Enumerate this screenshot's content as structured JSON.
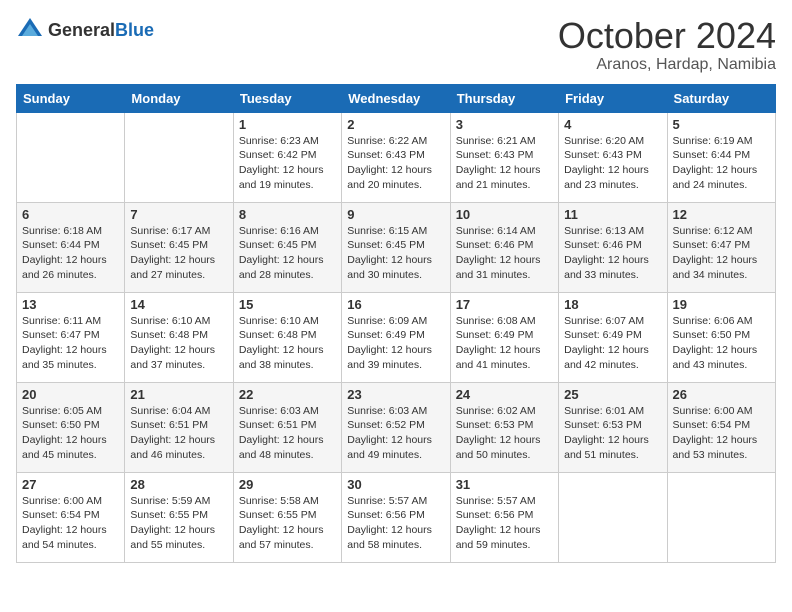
{
  "logo": {
    "general": "General",
    "blue": "Blue"
  },
  "header": {
    "month": "October 2024",
    "location": "Aranos, Hardap, Namibia"
  },
  "weekdays": [
    "Sunday",
    "Monday",
    "Tuesday",
    "Wednesday",
    "Thursday",
    "Friday",
    "Saturday"
  ],
  "weeks": [
    [
      {
        "day": "",
        "info": ""
      },
      {
        "day": "",
        "info": ""
      },
      {
        "day": "1",
        "info": "Sunrise: 6:23 AM\nSunset: 6:42 PM\nDaylight: 12 hours and 19 minutes."
      },
      {
        "day": "2",
        "info": "Sunrise: 6:22 AM\nSunset: 6:43 PM\nDaylight: 12 hours and 20 minutes."
      },
      {
        "day": "3",
        "info": "Sunrise: 6:21 AM\nSunset: 6:43 PM\nDaylight: 12 hours and 21 minutes."
      },
      {
        "day": "4",
        "info": "Sunrise: 6:20 AM\nSunset: 6:43 PM\nDaylight: 12 hours and 23 minutes."
      },
      {
        "day": "5",
        "info": "Sunrise: 6:19 AM\nSunset: 6:44 PM\nDaylight: 12 hours and 24 minutes."
      }
    ],
    [
      {
        "day": "6",
        "info": "Sunrise: 6:18 AM\nSunset: 6:44 PM\nDaylight: 12 hours and 26 minutes."
      },
      {
        "day": "7",
        "info": "Sunrise: 6:17 AM\nSunset: 6:45 PM\nDaylight: 12 hours and 27 minutes."
      },
      {
        "day": "8",
        "info": "Sunrise: 6:16 AM\nSunset: 6:45 PM\nDaylight: 12 hours and 28 minutes."
      },
      {
        "day": "9",
        "info": "Sunrise: 6:15 AM\nSunset: 6:45 PM\nDaylight: 12 hours and 30 minutes."
      },
      {
        "day": "10",
        "info": "Sunrise: 6:14 AM\nSunset: 6:46 PM\nDaylight: 12 hours and 31 minutes."
      },
      {
        "day": "11",
        "info": "Sunrise: 6:13 AM\nSunset: 6:46 PM\nDaylight: 12 hours and 33 minutes."
      },
      {
        "day": "12",
        "info": "Sunrise: 6:12 AM\nSunset: 6:47 PM\nDaylight: 12 hours and 34 minutes."
      }
    ],
    [
      {
        "day": "13",
        "info": "Sunrise: 6:11 AM\nSunset: 6:47 PM\nDaylight: 12 hours and 35 minutes."
      },
      {
        "day": "14",
        "info": "Sunrise: 6:10 AM\nSunset: 6:48 PM\nDaylight: 12 hours and 37 minutes."
      },
      {
        "day": "15",
        "info": "Sunrise: 6:10 AM\nSunset: 6:48 PM\nDaylight: 12 hours and 38 minutes."
      },
      {
        "day": "16",
        "info": "Sunrise: 6:09 AM\nSunset: 6:49 PM\nDaylight: 12 hours and 39 minutes."
      },
      {
        "day": "17",
        "info": "Sunrise: 6:08 AM\nSunset: 6:49 PM\nDaylight: 12 hours and 41 minutes."
      },
      {
        "day": "18",
        "info": "Sunrise: 6:07 AM\nSunset: 6:49 PM\nDaylight: 12 hours and 42 minutes."
      },
      {
        "day": "19",
        "info": "Sunrise: 6:06 AM\nSunset: 6:50 PM\nDaylight: 12 hours and 43 minutes."
      }
    ],
    [
      {
        "day": "20",
        "info": "Sunrise: 6:05 AM\nSunset: 6:50 PM\nDaylight: 12 hours and 45 minutes."
      },
      {
        "day": "21",
        "info": "Sunrise: 6:04 AM\nSunset: 6:51 PM\nDaylight: 12 hours and 46 minutes."
      },
      {
        "day": "22",
        "info": "Sunrise: 6:03 AM\nSunset: 6:51 PM\nDaylight: 12 hours and 48 minutes."
      },
      {
        "day": "23",
        "info": "Sunrise: 6:03 AM\nSunset: 6:52 PM\nDaylight: 12 hours and 49 minutes."
      },
      {
        "day": "24",
        "info": "Sunrise: 6:02 AM\nSunset: 6:53 PM\nDaylight: 12 hours and 50 minutes."
      },
      {
        "day": "25",
        "info": "Sunrise: 6:01 AM\nSunset: 6:53 PM\nDaylight: 12 hours and 51 minutes."
      },
      {
        "day": "26",
        "info": "Sunrise: 6:00 AM\nSunset: 6:54 PM\nDaylight: 12 hours and 53 minutes."
      }
    ],
    [
      {
        "day": "27",
        "info": "Sunrise: 6:00 AM\nSunset: 6:54 PM\nDaylight: 12 hours and 54 minutes."
      },
      {
        "day": "28",
        "info": "Sunrise: 5:59 AM\nSunset: 6:55 PM\nDaylight: 12 hours and 55 minutes."
      },
      {
        "day": "29",
        "info": "Sunrise: 5:58 AM\nSunset: 6:55 PM\nDaylight: 12 hours and 57 minutes."
      },
      {
        "day": "30",
        "info": "Sunrise: 5:57 AM\nSunset: 6:56 PM\nDaylight: 12 hours and 58 minutes."
      },
      {
        "day": "31",
        "info": "Sunrise: 5:57 AM\nSunset: 6:56 PM\nDaylight: 12 hours and 59 minutes."
      },
      {
        "day": "",
        "info": ""
      },
      {
        "day": "",
        "info": ""
      }
    ]
  ]
}
